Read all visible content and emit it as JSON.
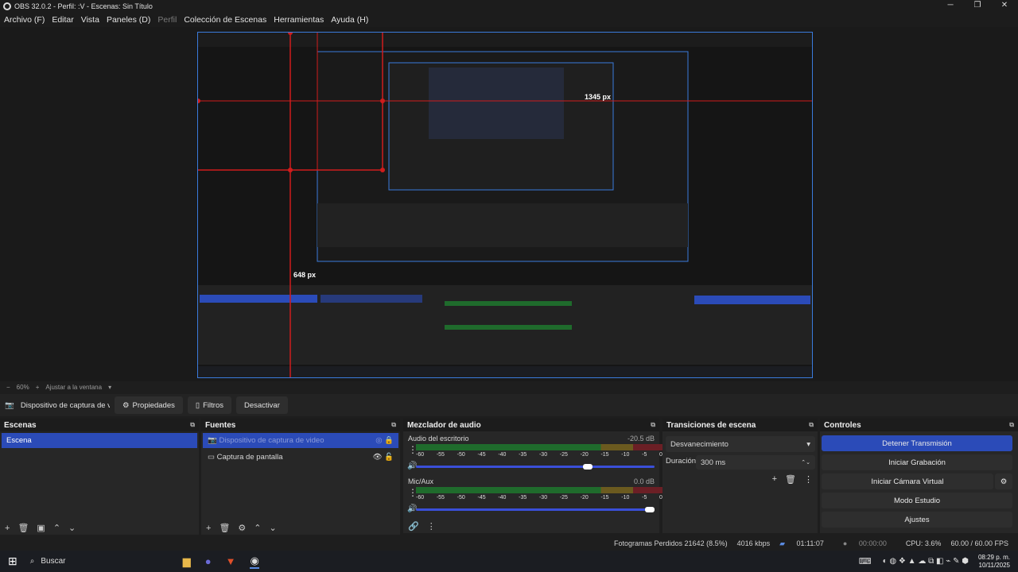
{
  "window": {
    "title": "OBS 32.0.2 - Perfil: :V - Escenas: Sin Título",
    "controls": [
      "─",
      "❐",
      "✕"
    ]
  },
  "menu": [
    "Archivo (F)",
    "Editar",
    "Vista",
    "Paneles (D)",
    "Perfil",
    "Colección de Escenas",
    "Herramientas",
    "Ayuda (H)"
  ],
  "preview": {
    "measure_h": "1345 px",
    "measure_v": "648 px"
  },
  "zoom": {
    "minus": "−",
    "value": "60%",
    "plus": "+",
    "fit": "Ajustar a la ventana"
  },
  "source_bar": {
    "name": "Dispositivo de captura de v",
    "props": "Propiedades",
    "filters": "Filtros",
    "deactivate": "Desactivar"
  },
  "scenes": {
    "title": "Escenas",
    "items": [
      "Escena"
    ]
  },
  "sources": {
    "title": "Fuentes",
    "items": [
      "Dispositivo de captura de video",
      "Captura de pantalla"
    ]
  },
  "mixer": {
    "title": "Mezclador de audio",
    "channels": [
      {
        "name": "Audio del escritorio",
        "db": "-20.5 dB",
        "level": 0.72
      },
      {
        "name": "Mic/Aux",
        "db": "0.0 dB",
        "level": 1.0
      }
    ],
    "scale": [
      "-60",
      "-55",
      "-50",
      "-45",
      "-40",
      "-35",
      "-30",
      "-25",
      "-20",
      "-15",
      "-10",
      "-5",
      "0"
    ]
  },
  "transitions": {
    "title": "Transiciones de escena",
    "selected": "Desvanecimiento",
    "duration_label": "Duración",
    "duration_value": "300 ms"
  },
  "controls": {
    "title": "Controles",
    "stop_stream": "Detener Transmisión",
    "start_rec": "Iniciar Grabación",
    "virtual_cam": "Iniciar Cámara Virtual",
    "studio": "Modo Estudio",
    "settings": "Ajustes"
  },
  "status": {
    "dropped": "Fotogramas Perdidos 21642 (8.5%)",
    "kbps": "4016 kbps",
    "stream_time": "01:11:07",
    "rec_time": "00:00:00",
    "cpu": "CPU: 3.6%",
    "fps": "60.00 / 60.00 FPS"
  },
  "taskbar": {
    "search": "Buscar",
    "time": "08:29 p. m.",
    "date": "10/11/2025"
  },
  "colors": {
    "accent": "#2b4bb8",
    "stream_button": "#2b4bb8",
    "recursive_lines": "#d01c1c"
  }
}
